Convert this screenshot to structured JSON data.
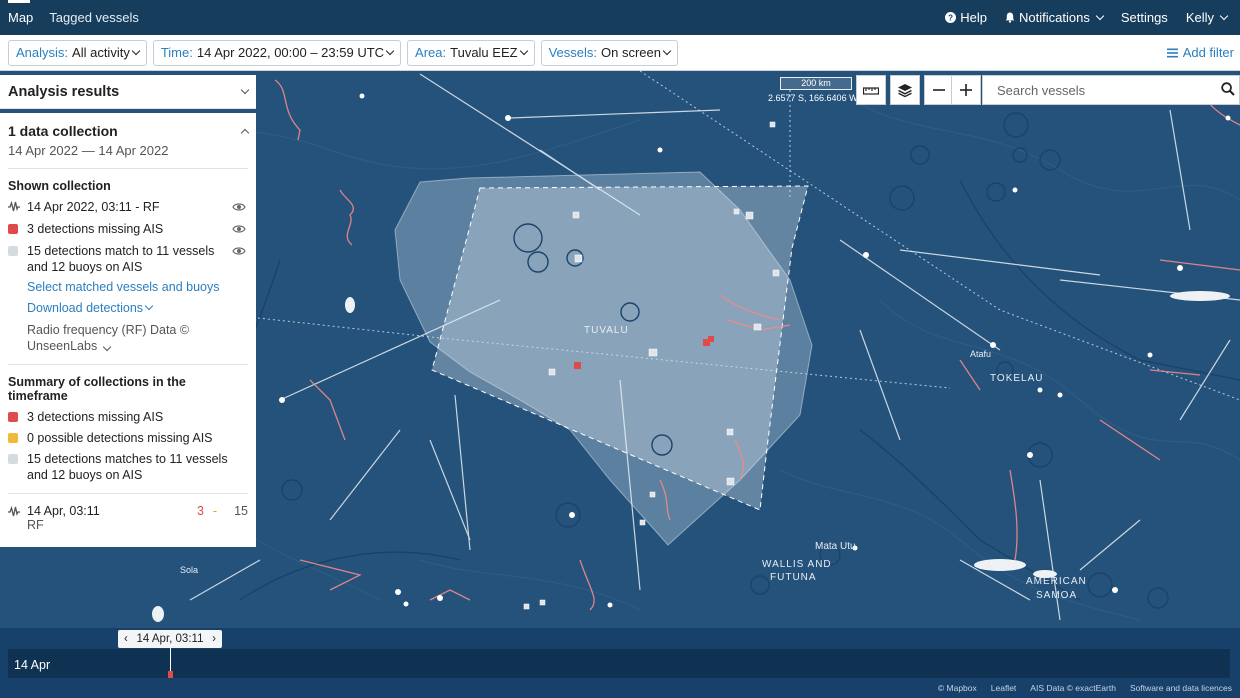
{
  "nav": {
    "tabs": [
      {
        "label": "Map"
      },
      {
        "label": "Tagged vessels"
      }
    ],
    "help": "Help",
    "notifications": "Notifications",
    "settings": "Settings",
    "user": "Kelly"
  },
  "filters": {
    "analysis": {
      "key": "Analysis:",
      "value": "All activity"
    },
    "time": {
      "key": "Time:",
      "value": "14 Apr 2022, 00:00 – 23:59 UTC"
    },
    "area": {
      "key": "Area:",
      "value": "Tuvalu EEZ"
    },
    "vessels": {
      "key": "Vessels:",
      "value": "On screen"
    },
    "add": "Add filter"
  },
  "map": {
    "scale": "200 km",
    "coords": "2.6577 S, 166.6406 W",
    "search_placeholder": "Search vessels",
    "labels": [
      "TUVALU",
      "Atafu",
      "TOKELAU",
      "Mata Utu",
      "WALLIS AND",
      "FUTUNA",
      "SAMOA",
      "AMERICAN",
      "SAMOA",
      "Sola"
    ],
    "colors": {
      "ocean": "#24527a",
      "aoi": "#c7d8e6",
      "detection": "#e04a4a",
      "track": "#f08a8a",
      "vessel": "#ffffff"
    }
  },
  "panel": {
    "title": "Analysis results",
    "collection_title": "1 data collection",
    "collection_range": "14 Apr 2022 — 14 Apr 2022",
    "shown_label": "Shown collection",
    "rf_item": "14 Apr 2022, 03:11 - RF",
    "missing": "3 detections missing AIS",
    "matched": "15 detections match to 11 vessels and 12 buoys on AIS",
    "select_link": "Select matched vessels and buoys",
    "download": "Download detections",
    "source_1": "Radio frequency (RF) Data ©",
    "source_2": "UnseenLabs",
    "summary_label": "Summary of collections in the timeframe",
    "summary": [
      {
        "text": "3 detections missing AIS",
        "color": "#e04a4a"
      },
      {
        "text": "0 possible detections missing AIS",
        "color": "#f0b93a"
      },
      {
        "text": "15 detections matches to 11 vessels and 12 buoys on AIS",
        "color": "#d6dbe0"
      }
    ],
    "row": {
      "label": "14 Apr, 03:11",
      "type": "RF",
      "missing": "3",
      "sep": "-",
      "matched": "15"
    }
  },
  "timeline": {
    "current": "14 Apr, 03:11",
    "date": "14 Apr",
    "credits": [
      "© Mapbox",
      "Leaflet",
      "AIS Data © exactEarth",
      "Software and data licences"
    ]
  }
}
